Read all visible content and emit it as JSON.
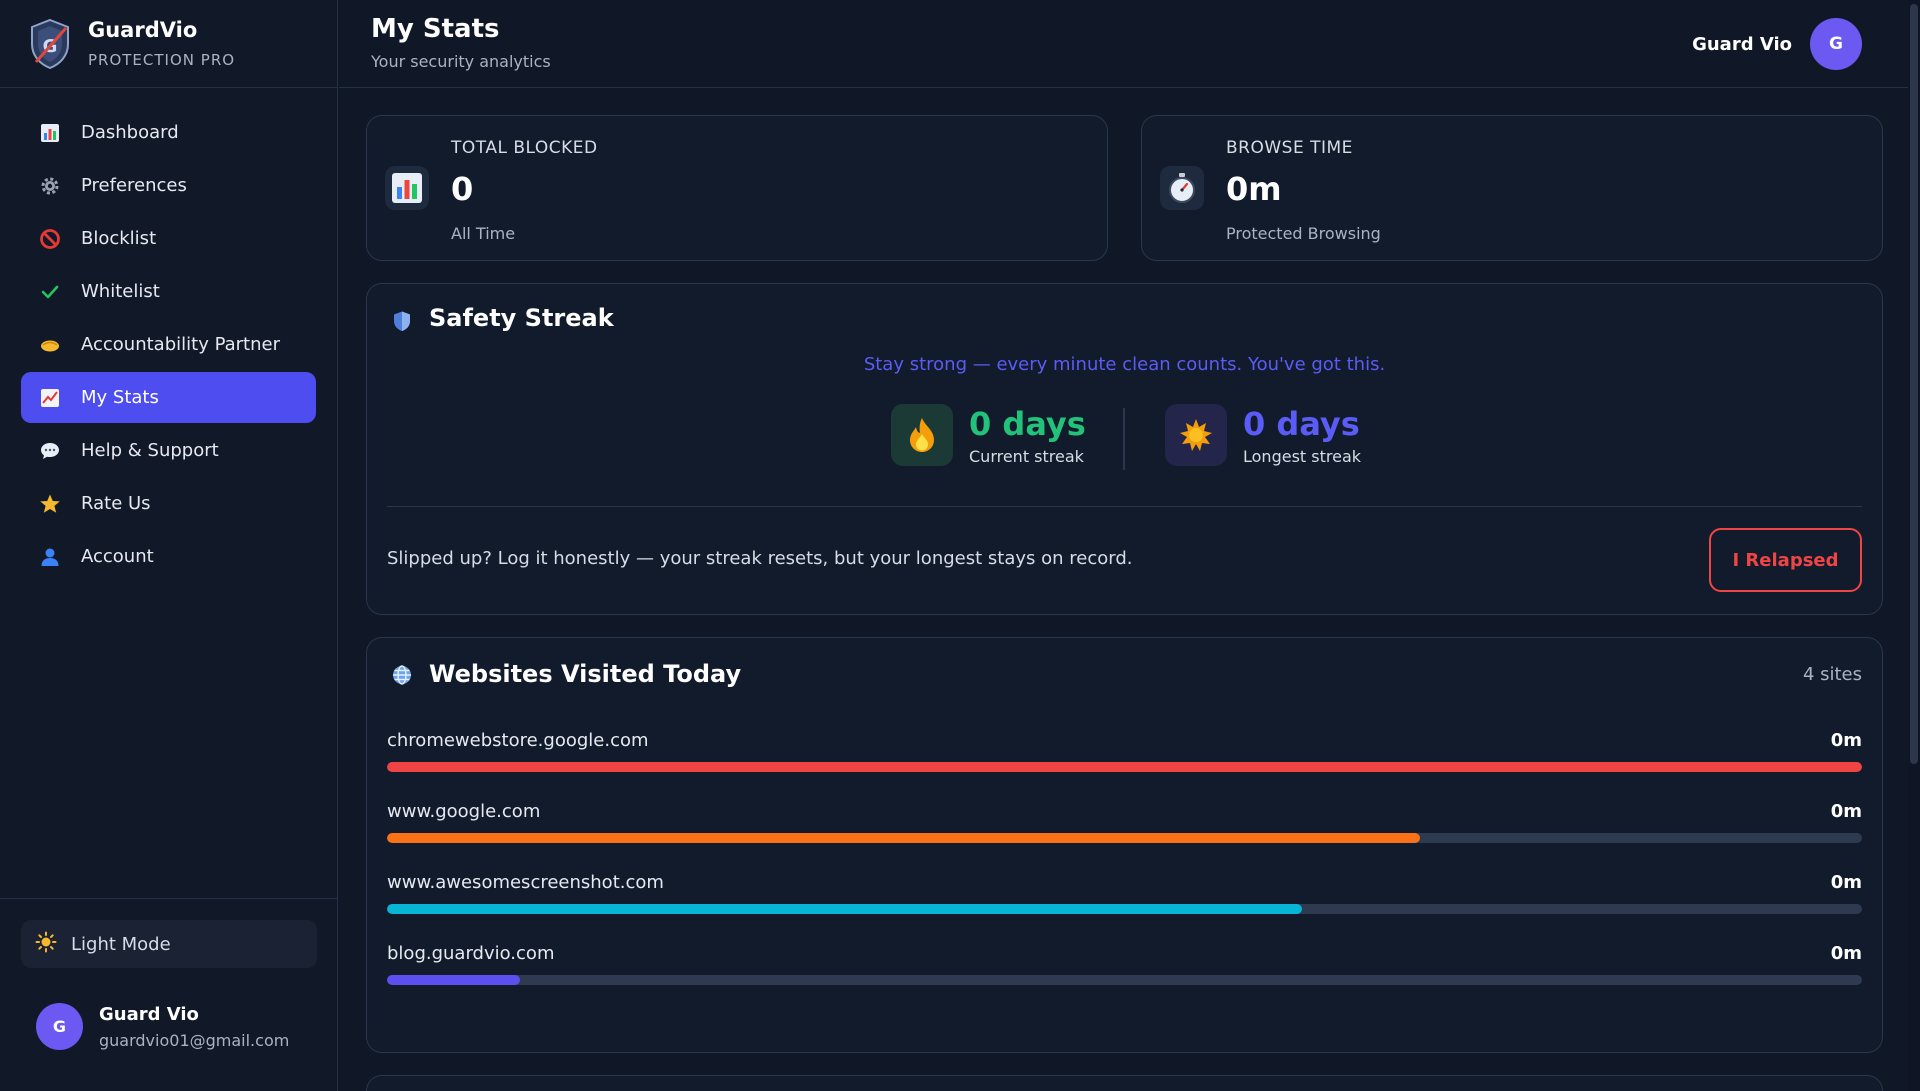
{
  "brand": {
    "name": "GuardVio",
    "subtitle": "PROTECTION PRO"
  },
  "sidebar": {
    "items": [
      {
        "label": "Dashboard",
        "icon": "bar-chart-icon",
        "active": false
      },
      {
        "label": "Preferences",
        "icon": "gear-icon",
        "active": false
      },
      {
        "label": "Blocklist",
        "icon": "prohibited-icon",
        "active": false
      },
      {
        "label": "Whitelist",
        "icon": "check-icon",
        "active": false
      },
      {
        "label": "Accountability Partner",
        "icon": "handshake-icon",
        "active": false
      },
      {
        "label": "My Stats",
        "icon": "chart-up-icon",
        "active": true
      },
      {
        "label": "Help & Support",
        "icon": "speech-bubble-icon",
        "active": false
      },
      {
        "label": "Rate Us",
        "icon": "star-icon",
        "active": false
      },
      {
        "label": "Account",
        "icon": "user-icon",
        "active": false
      }
    ],
    "light_mode_label": "Light Mode",
    "user": {
      "initial": "G",
      "name": "Guard Vio",
      "email": "guardvio01@gmail.com"
    }
  },
  "header": {
    "title": "My Stats",
    "subtitle": "Your security analytics",
    "user_name": "Guard Vio",
    "user_initial": "G"
  },
  "stats": {
    "total_blocked": {
      "label": "TOTAL BLOCKED",
      "value": "0",
      "note": "All Time",
      "icon": "bar-chart-icon"
    },
    "browse_time": {
      "label": "BROWSE TIME",
      "value": "0m",
      "note": "Protected Browsing",
      "icon": "stopwatch-icon"
    }
  },
  "streak": {
    "title": "Safety Streak",
    "icon": "shield-icon",
    "motivation": "Stay strong — every minute clean counts. You've got this.",
    "current": {
      "value": "0 days",
      "label": "Current streak",
      "icon": "fire-icon"
    },
    "longest": {
      "value": "0 days",
      "label": "Longest streak",
      "icon": "sun-icon"
    },
    "relapse_text": "Slipped up? Log it honestly — your streak resets, but your longest stays on record.",
    "relapse_button": "I Relapsed"
  },
  "websites": {
    "title": "Websites Visited Today",
    "icon": "globe-icon",
    "count": "4 sites",
    "items": [
      {
        "name": "chromewebstore.google.com",
        "time": "0m",
        "fill": 1.0,
        "color": "#ef4444"
      },
      {
        "name": "www.google.com",
        "time": "0m",
        "fill": 0.7,
        "color": "#f97316"
      },
      {
        "name": "www.awesomescreenshot.com",
        "time": "0m",
        "fill": 0.62,
        "color": "#06b6d4"
      },
      {
        "name": "blog.guardvio.com",
        "time": "0m",
        "fill": 0.09,
        "color": "#5b4ff0"
      }
    ]
  },
  "colors": {
    "accent": "#4e4df0",
    "current_streak": "#22c27a",
    "longest_streak": "#5b5cf5",
    "danger": "#f04545"
  }
}
